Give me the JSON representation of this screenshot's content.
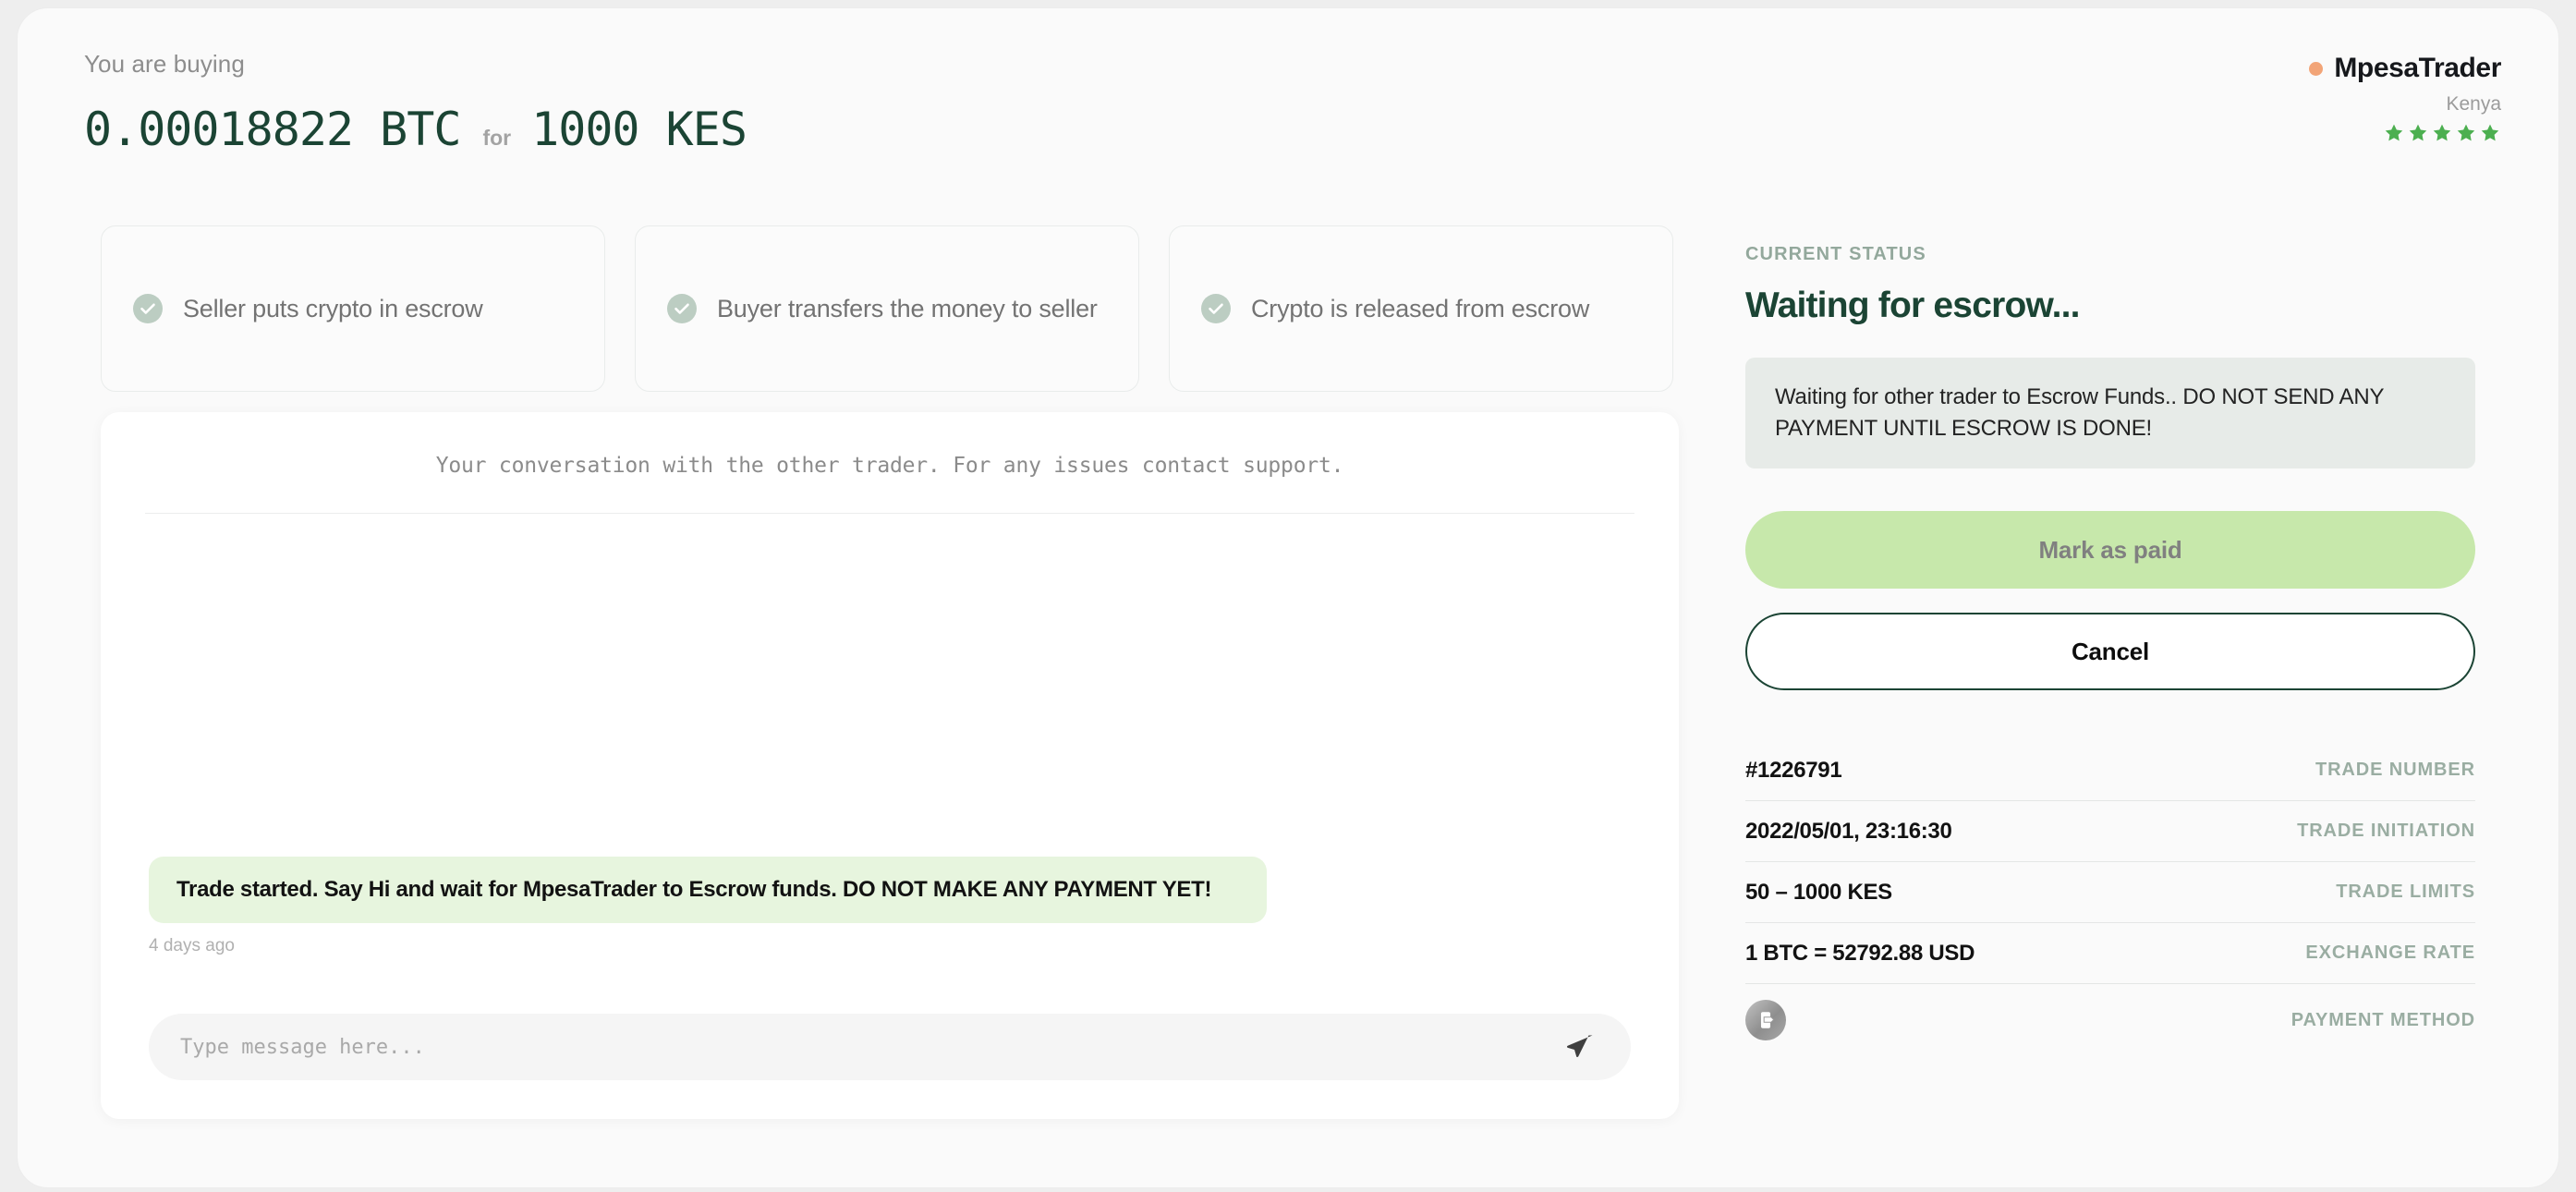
{
  "header": {
    "eyebrow": "You are buying",
    "crypto_amount": "0.00018822 BTC",
    "for_label": "for",
    "fiat_amount": "1000 KES"
  },
  "brand": {
    "name": "MpesaTrader",
    "country": "Kenya",
    "rating": 5,
    "dot_color": "#f2a477",
    "star_color": "#4caf50"
  },
  "steps": [
    {
      "label": "Seller puts crypto in escrow",
      "done": true
    },
    {
      "label": "Buyer transfers the money to seller",
      "done": true
    },
    {
      "label": "Crypto is released from escrow",
      "done": true
    }
  ],
  "chat": {
    "note": "Your conversation with the other trader. For any issues contact support.",
    "messages": [
      {
        "text": "Trade started. Say Hi and wait for MpesaTrader to Escrow funds. DO NOT MAKE ANY PAYMENT YET!",
        "time": "4 days ago"
      }
    ],
    "input_placeholder": "Type message here...",
    "input_value": "",
    "send_icon": "paper-plane-icon"
  },
  "sidebar": {
    "eyebrow": "CURRENT STATUS",
    "title": "Waiting for escrow...",
    "alert": "Waiting for other trader to Escrow Funds.. DO NOT SEND ANY PAYMENT UNTIL ESCROW IS DONE!",
    "primary_button": "Mark as paid",
    "secondary_button": "Cancel",
    "details": [
      {
        "value": "#1226791",
        "key": "TRADE NUMBER"
      },
      {
        "value": "2022/05/01, 23:16:30",
        "key": "TRADE INITIATION"
      },
      {
        "value": "50 – 1000 KES",
        "key": "TRADE LIMITS"
      },
      {
        "value": "1 BTC = 52792.88 USD",
        "key": "EXCHANGE RATE"
      }
    ],
    "payment_method": {
      "key": "PAYMENT METHOD",
      "icon": "mobile-money-icon"
    }
  },
  "colors": {
    "accent_green": "#1b4434",
    "button_green": "#c7e8ab",
    "bubble_green": "#e7f5de",
    "page_bg": "#fafafa"
  }
}
